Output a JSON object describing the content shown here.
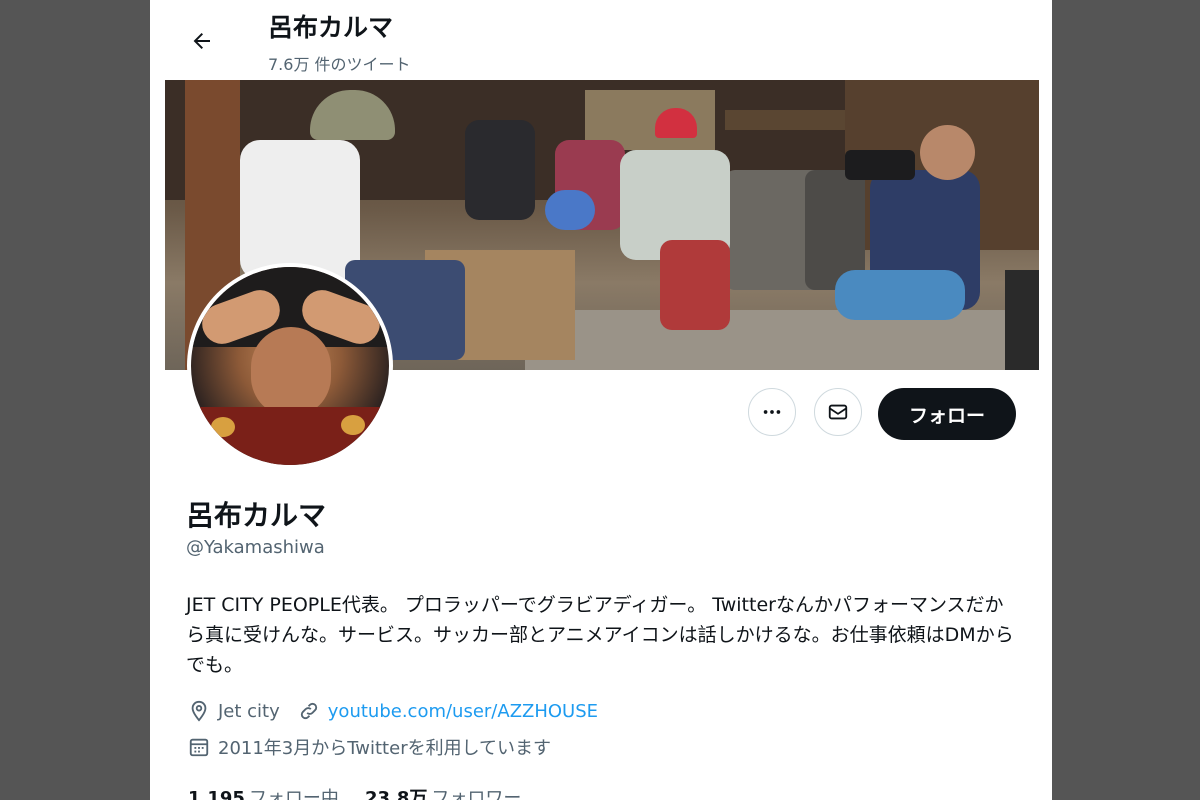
{
  "header": {
    "title": "呂布カルマ",
    "tweet_count": "7.6万 件のツイート"
  },
  "profile": {
    "name": "呂布カルマ",
    "handle": "@Yakamashiwa",
    "bio": "JET CITY PEOPLE代表。 プロラッパーでグラビアディガー。 Twitterなんかパフォーマンスだから真に受けんな。サービス。サッカー部とアニメアイコンは話しかけるな。お仕事依頼はDMからでも。",
    "location": "Jet city",
    "website": "youtube.com/user/AZZHOUSE",
    "joined": "2011年3月からTwitterを利用しています"
  },
  "actions": {
    "follow_label": "フォロー",
    "more_icon": "more-icon",
    "message_icon": "mail-icon"
  },
  "stats": {
    "following_count": "1,195",
    "following_label": "フォロー中",
    "followers_count": "23.8万",
    "followers_label": "フォロワー"
  },
  "colors": {
    "accent": "#1d9bf0",
    "text": "#0f1419",
    "muted": "#536471",
    "follow_button": "#0f1419",
    "outer_background": "#555555"
  }
}
